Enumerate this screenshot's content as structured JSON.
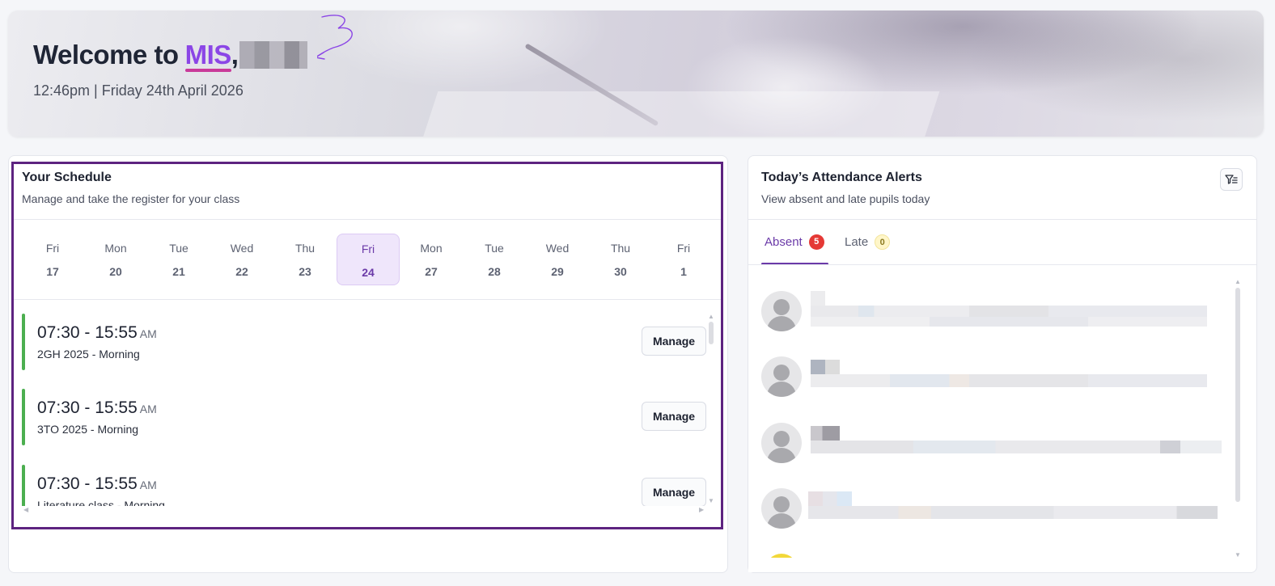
{
  "banner": {
    "welcome_prefix": "Welcome to",
    "brand": "MIS",
    "comma": ",",
    "datetime": "12:46pm | Friday 24th April 2026"
  },
  "schedule": {
    "title": "Your Schedule",
    "subtitle": "Manage and take the register for your class",
    "days": [
      {
        "name": "Fri",
        "num": "17"
      },
      {
        "name": "Mon",
        "num": "20"
      },
      {
        "name": "Tue",
        "num": "21"
      },
      {
        "name": "Wed",
        "num": "22"
      },
      {
        "name": "Thu",
        "num": "23"
      },
      {
        "name": "Fri",
        "num": "24",
        "selected": true
      },
      {
        "name": "Mon",
        "num": "27"
      },
      {
        "name": "Tue",
        "num": "28"
      },
      {
        "name": "Wed",
        "num": "29"
      },
      {
        "name": "Thu",
        "num": "30"
      },
      {
        "name": "Fri",
        "num": "1"
      }
    ],
    "slots": [
      {
        "time": "07:30 - 15:55",
        "ampm": "AM",
        "class_name": "2GH 2025 - Morning",
        "action": "Manage"
      },
      {
        "time": "07:30 - 15:55",
        "ampm": "AM",
        "class_name": "3TO 2025 - Morning",
        "action": "Manage"
      },
      {
        "time": "07:30 - 15:55",
        "ampm": "AM",
        "class_name": "Literature class - Morning",
        "action": "Manage"
      }
    ]
  },
  "alerts": {
    "title": "Today’s Attendance Alerts",
    "subtitle": "View absent and late pupils today",
    "tabs": [
      {
        "label": "Absent",
        "count": "5",
        "active": true
      },
      {
        "label": "Late",
        "count": "0",
        "active": false
      }
    ],
    "filter_icon": "filter-list-icon",
    "avatar_icon": "person-icon"
  },
  "colors": {
    "accent": "#6b3aa8",
    "brand": "#8b46e6",
    "focus_outline": "#5d2380",
    "slot_bar": "#4caf50",
    "absent_badge": "#e53935",
    "late_badge": "#fff6c9"
  }
}
